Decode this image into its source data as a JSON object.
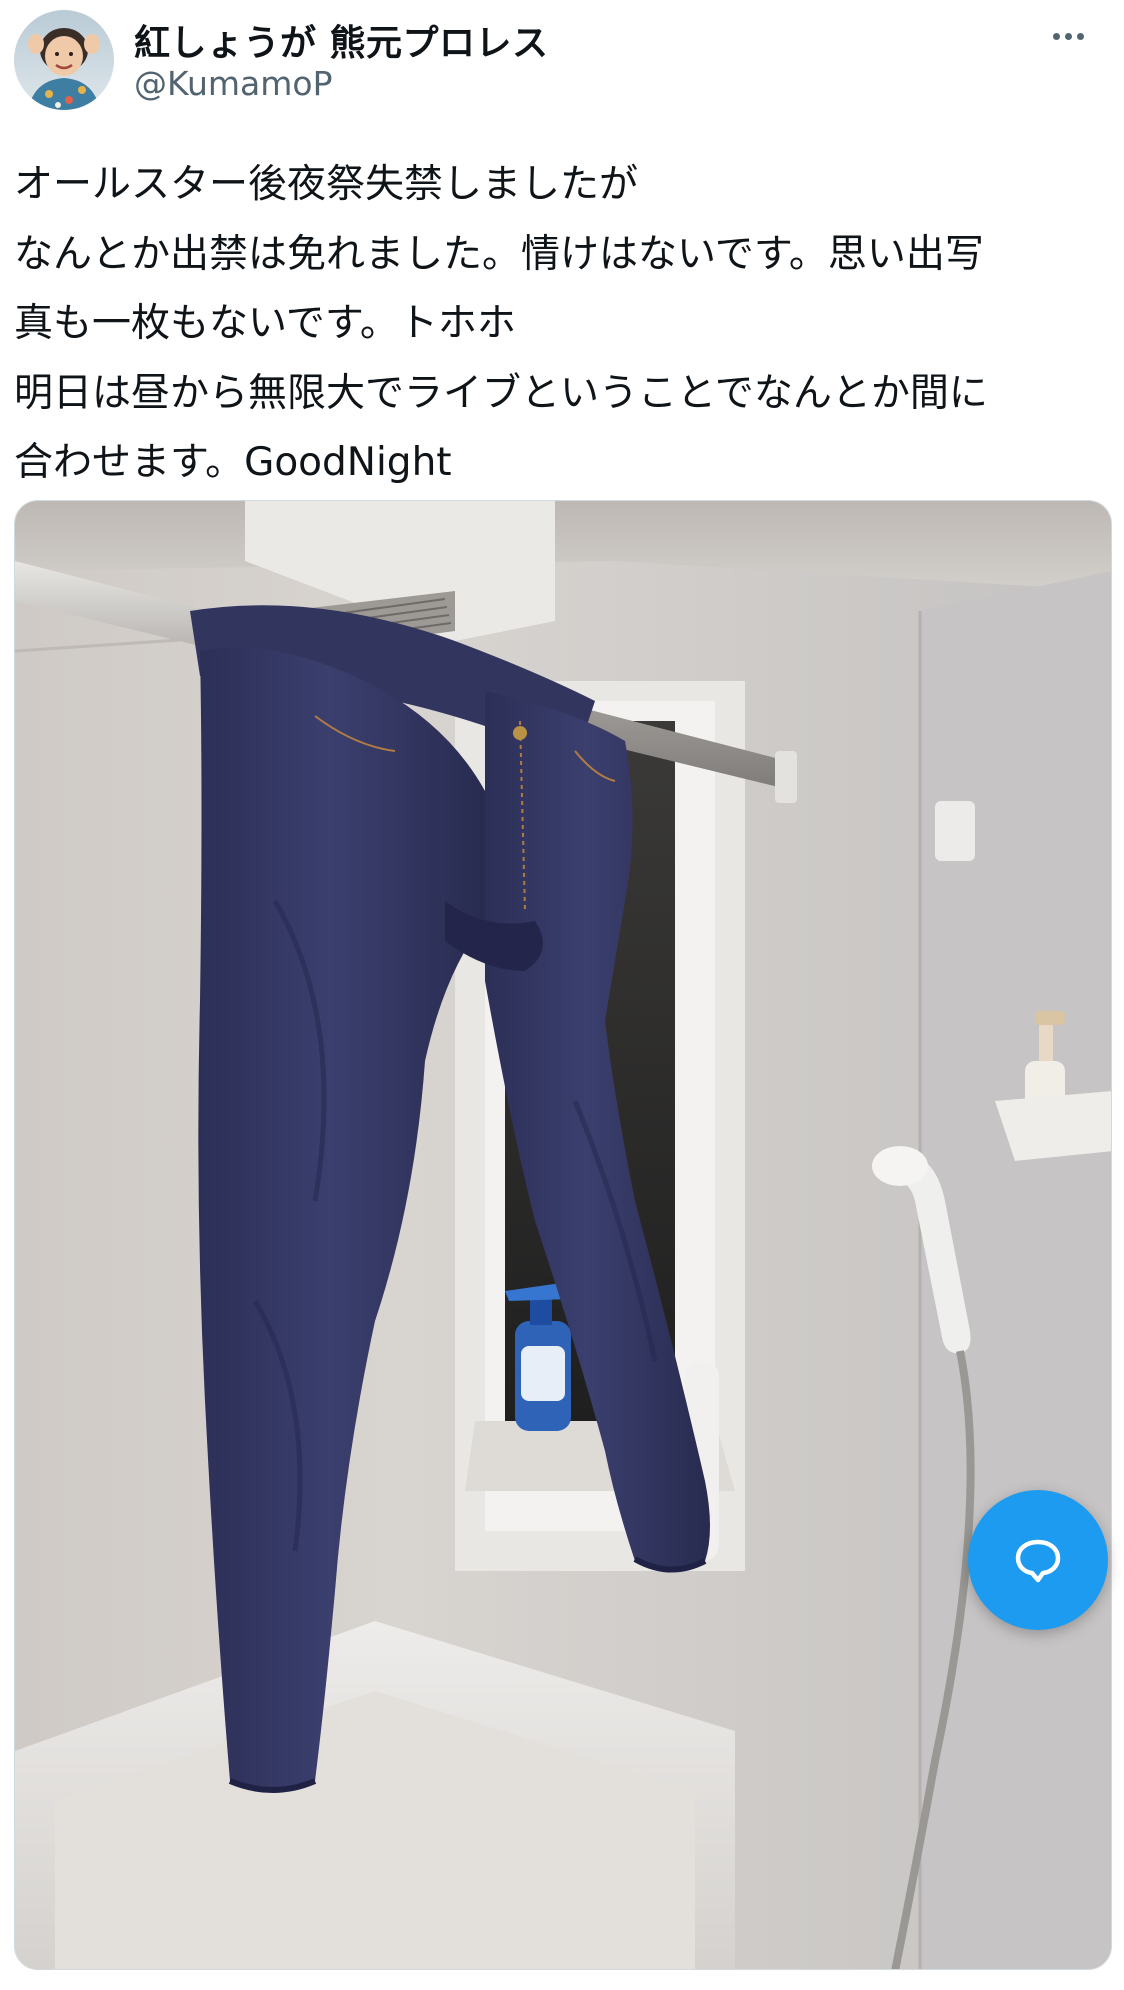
{
  "author": {
    "display_name": "紅しょうが 熊元プロレス",
    "handle": "@KumamoP",
    "avatar_icon": "avatar-photo-icon"
  },
  "more_icon": "more-dots-icon",
  "tweet": {
    "lines": [
      "オールスター後夜祭失禁しましたが",
      "なんとか出禁は免れました。情けはないです。思い出写",
      "真も一枚もないです。トホホ",
      "明日は昼から無限大でライブということでなんとか間に",
      "合わせます。GoodNight"
    ]
  },
  "media": {
    "icon": "photo-jeans-hanging-in-bathroom"
  },
  "fab": {
    "icon": "reply-bubble-icon",
    "color": "#1d9bf0"
  },
  "colors": {
    "text_primary": "#0f1419",
    "text_secondary": "#536471",
    "accent": "#1d9bf0",
    "border": "#cfd9de"
  }
}
